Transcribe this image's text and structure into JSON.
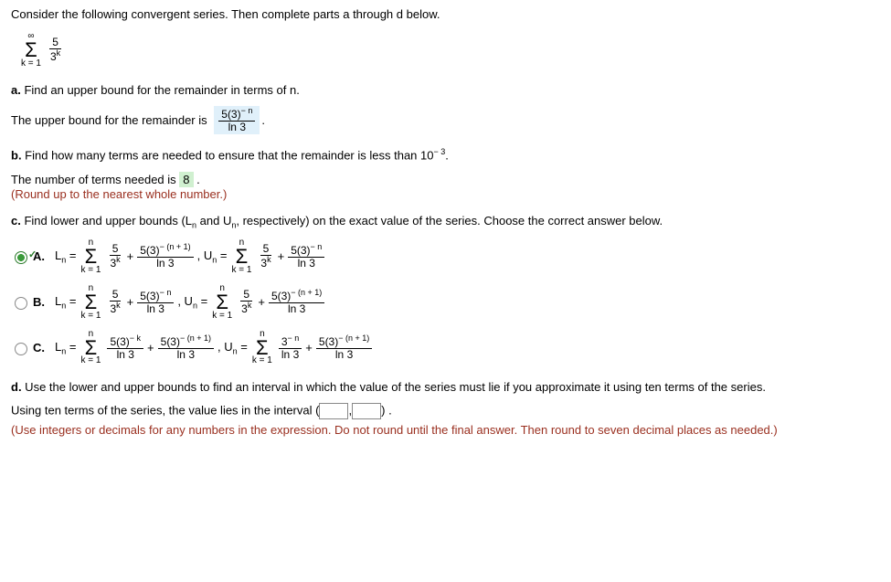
{
  "intro": "Consider the following convergent series. Then complete parts a through d below.",
  "series": {
    "top": "∞",
    "bottom": "k = 1",
    "frac_num": "5",
    "frac_den": "3",
    "frac_den_sup": "k"
  },
  "part_a": {
    "prompt": "a. Find an upper bound for the remainder in terms of n.",
    "lead": "The upper bound for the remainder is",
    "ans_num": "5(3)",
    "ans_num_sup": "− n",
    "ans_den": "ln 3",
    "period": "."
  },
  "part_b": {
    "prompt_prefix": "b. Find how many terms are needed to ensure that the remainder is less than 10",
    "prompt_exp": "− 3",
    "prompt_suffix": ".",
    "lead": "The number of terms needed is",
    "answer": "8",
    "period": ".",
    "hint": "(Round up to the nearest whole number.)"
  },
  "part_c": {
    "prompt": "c. Find lower and upper bounds (Lₙ and Uₙ, respectively) on the exact value of the series. Choose the correct answer below.",
    "options": [
      {
        "label": "A.",
        "selected": true,
        "ln_frac_num": "5",
        "ln_frac_den": "3",
        "ln_frac_den_sup": "k",
        "ln_tail_num": "5(3)",
        "ln_tail_sup": "− (n + 1)",
        "ln_tail_den": "ln 3",
        "un_frac_num": "5",
        "un_frac_den": "3",
        "un_frac_den_sup": "k",
        "un_tail_num": "5(3)",
        "un_tail_sup": "− n",
        "un_tail_den": "ln 3"
      },
      {
        "label": "B.",
        "selected": false,
        "ln_frac_num": "5",
        "ln_frac_den": "3",
        "ln_frac_den_sup": "k",
        "ln_tail_num": "5(3)",
        "ln_tail_sup": "− n",
        "ln_tail_den": "ln 3",
        "un_frac_num": "5",
        "un_frac_den": "3",
        "un_frac_den_sup": "k",
        "un_tail_num": "5(3)",
        "un_tail_sup": "− (n + 1)",
        "un_tail_den": "ln 3"
      },
      {
        "label": "C.",
        "selected": false,
        "ln_frac_num": "5(3)",
        "ln_frac_num_sup": "− k",
        "ln_frac_den": "ln 3",
        "ln_tail_num": "5(3)",
        "ln_tail_sup": "− (n + 1)",
        "ln_tail_den": "ln 3",
        "un_frac_num": "3",
        "un_frac_num_sup": "− n",
        "un_frac_den": "ln 3",
        "un_tail_num": "5(3)",
        "un_tail_sup": "− (n + 1)",
        "un_tail_den": "ln 3"
      }
    ],
    "sigma_top": "n",
    "sigma_bot": "k = 1",
    "ln_prefix": "Lₙ =",
    "un_prefix": ", Uₙ =",
    "plus": "+"
  },
  "part_d": {
    "prompt": "d. Use the lower and upper bounds to find an interval in which the value of the series must lie if you approximate it using ten terms of the series.",
    "lead": "Using ten terms of the series, the value lies in the interval",
    "paren_open": "(",
    "comma": ",",
    "paren_close": ")",
    "period": ".",
    "hint": "(Use integers or decimals for any numbers in the expression. Do not round until the final answer. Then round to seven decimal places as needed.)"
  }
}
